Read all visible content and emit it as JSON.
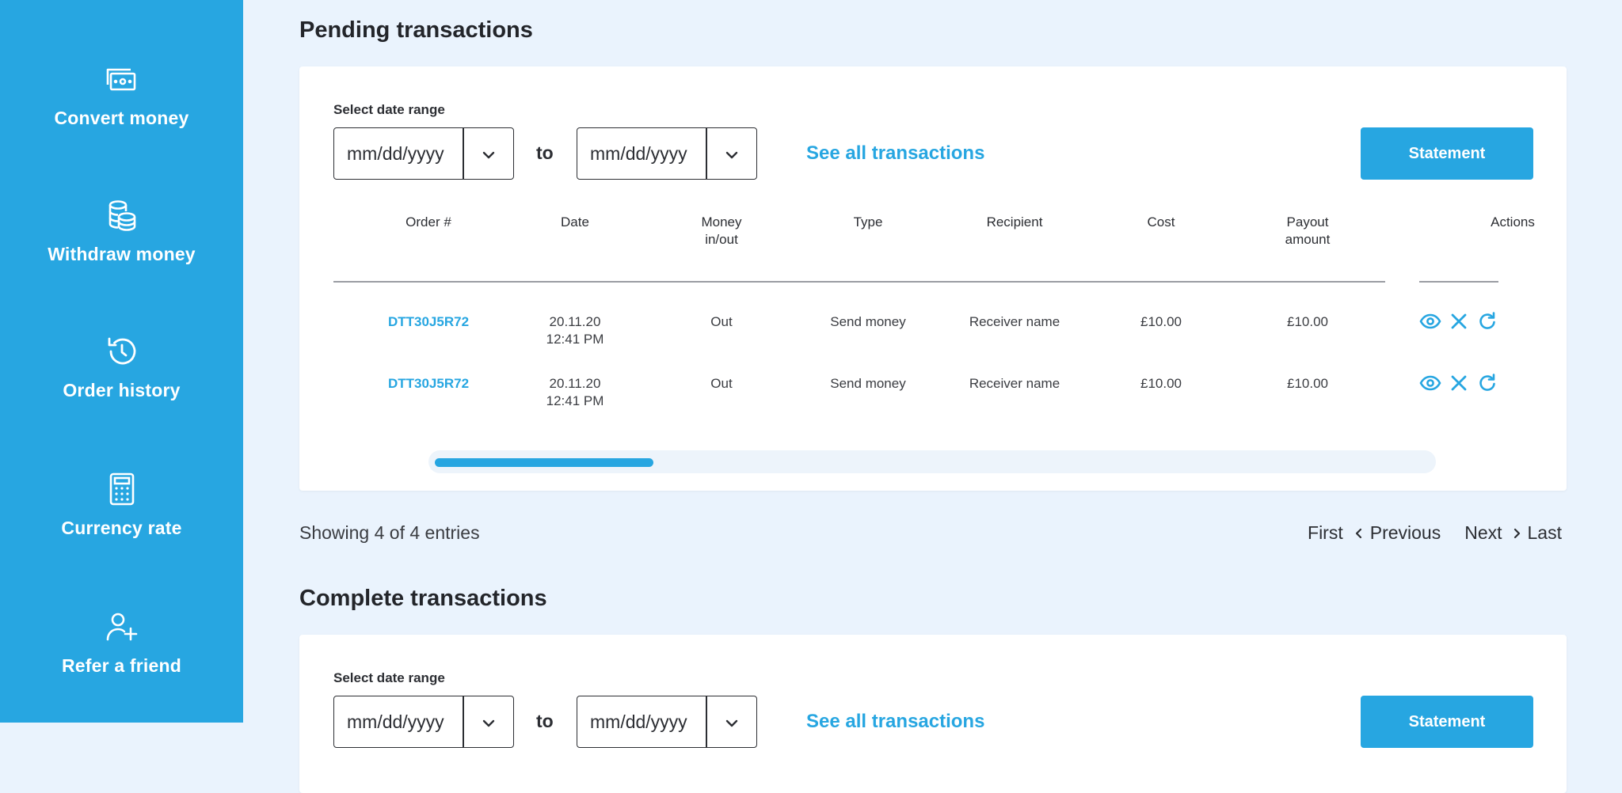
{
  "sidebar": {
    "items": [
      {
        "label": "Convert money",
        "icon": "convert-money-icon"
      },
      {
        "label": "Withdraw money",
        "icon": "coins-icon"
      },
      {
        "label": "Order history",
        "icon": "history-icon"
      },
      {
        "label": "Currency rate",
        "icon": "calculator-icon"
      },
      {
        "label": "Refer a friend",
        "icon": "add-user-icon"
      }
    ]
  },
  "colors": {
    "accent": "#27a6e1",
    "background": "#eaf3fd",
    "text": "#2c2e33"
  },
  "pending": {
    "title": "Pending transactions",
    "range_label": "Select date range",
    "from_placeholder": "mm/dd/yyyy",
    "to_text": "to",
    "to_placeholder": "mm/dd/yyyy",
    "see_all": "See all transactions",
    "statement": "Statement",
    "headers": {
      "order": "Order #",
      "date": "Date",
      "money_line1": "Money",
      "money_line2": "in/out",
      "type": "Type",
      "recipient": "Recipient",
      "cost": "Cost",
      "payout_line1": "Payout",
      "payout_line2": "amount",
      "actions": "Actions"
    },
    "rows": [
      {
        "order": "DTT30J5R72",
        "date": "20.11.20",
        "time": "12:41 PM",
        "money": "Out",
        "type": "Send money",
        "recipient": "Receiver name",
        "cost": "£10.00",
        "payout": "£10.00"
      },
      {
        "order": "DTT30J5R72",
        "date": "20.11.20",
        "time": "12:41 PM",
        "money": "Out",
        "type": "Send money",
        "recipient": "Receiver name",
        "cost": "£10.00",
        "payout": "£10.00"
      }
    ],
    "scroll_fraction": 0.22,
    "showing": "Showing 4 of 4 entries",
    "pager": {
      "first": "First",
      "previous": "Previous",
      "next": "Next",
      "last": "Last"
    }
  },
  "complete": {
    "title": "Complete transactions",
    "range_label": "Select date range",
    "from_placeholder": "mm/dd/yyyy",
    "to_text": "to",
    "to_placeholder": "mm/dd/yyyy",
    "see_all": "See all transactions",
    "statement": "Statement"
  }
}
